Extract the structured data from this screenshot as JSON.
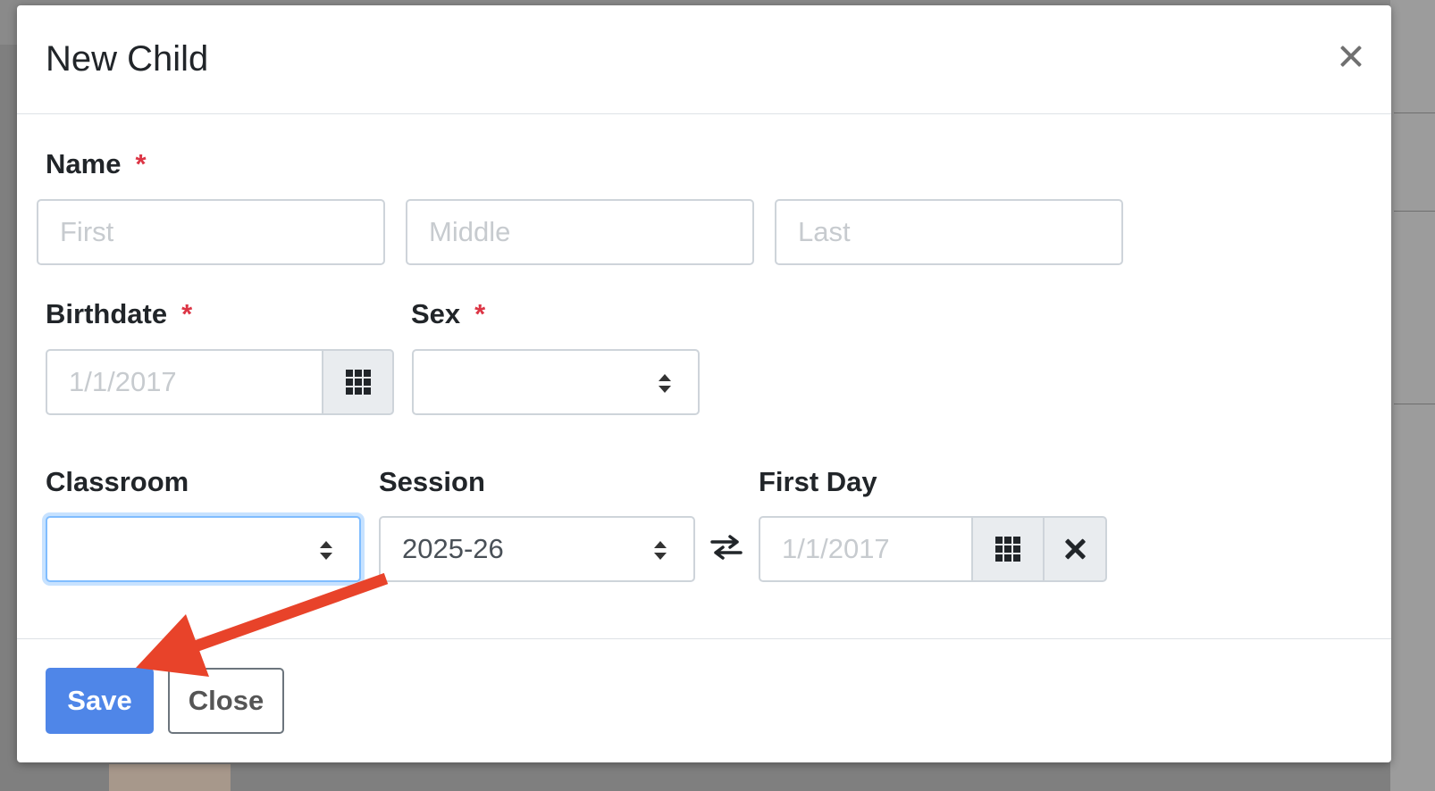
{
  "modal": {
    "title": "New Child",
    "close_icon": "close-icon"
  },
  "form": {
    "name": {
      "label": "Name",
      "required_mark": "*",
      "first_placeholder": "First",
      "middle_placeholder": "Middle",
      "last_placeholder": "Last"
    },
    "birthdate": {
      "label": "Birthdate",
      "required_mark": "*",
      "placeholder": "1/1/2017",
      "calendar_icon": "calendar-grid-icon"
    },
    "sex": {
      "label": "Sex",
      "required_mark": "*",
      "value": ""
    },
    "classroom": {
      "label": "Classroom",
      "value": ""
    },
    "session": {
      "label": "Session",
      "value": "2025-26"
    },
    "swap_icon": "swap-arrows-icon",
    "first_day": {
      "label": "First Day",
      "placeholder": "1/1/2017",
      "calendar_icon": "calendar-grid-icon",
      "clear_icon": "clear-icon"
    }
  },
  "footer": {
    "save_label": "Save",
    "close_label": "Close"
  },
  "annotation": {
    "arrow_color": "#e8432a"
  },
  "colors": {
    "primary": "#4f86e8",
    "required": "#dc3545",
    "focus": "#80bdff"
  }
}
